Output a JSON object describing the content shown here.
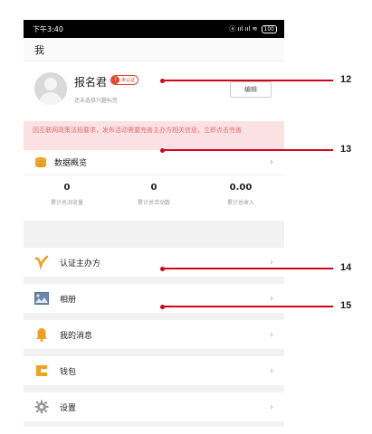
{
  "statusbar": {
    "time": "下午3:40",
    "icons": "ⓐ ııl ııl ≋",
    "battery": "100"
  },
  "header": {
    "title": "我"
  },
  "profile": {
    "username": "报名君",
    "badge_label": "未认证",
    "badge_mark": "!",
    "tag_hint": "还未选择兴趣标签",
    "edit_label": "编辑"
  },
  "notice": {
    "text": "因互联网政策法规要求，发布活动需要完善主办方相关信息，立即点击完善"
  },
  "overview": {
    "title": "数据概览",
    "stats": [
      {
        "value": "0",
        "label": "累计总浏览量"
      },
      {
        "value": "0",
        "label": "累计总活动数"
      },
      {
        "value": "0.00",
        "label": "累计总收入"
      }
    ]
  },
  "menu": [
    {
      "label": "认证主办方",
      "icon": "v-logo-icon"
    },
    {
      "label": "相册",
      "icon": "photo-album-icon"
    },
    {
      "label": "我的消息",
      "icon": "bell-icon"
    },
    {
      "label": "钱包",
      "icon": "wallet-icon"
    },
    {
      "label": "设置",
      "icon": "gear-icon"
    }
  ],
  "callouts": [
    "12",
    "13",
    "14",
    "15"
  ],
  "colors": {
    "accent": "#e0492e",
    "notice_bg": "#fbe1e3",
    "notice_text": "#e26d6d",
    "callout": "#d0021b"
  }
}
